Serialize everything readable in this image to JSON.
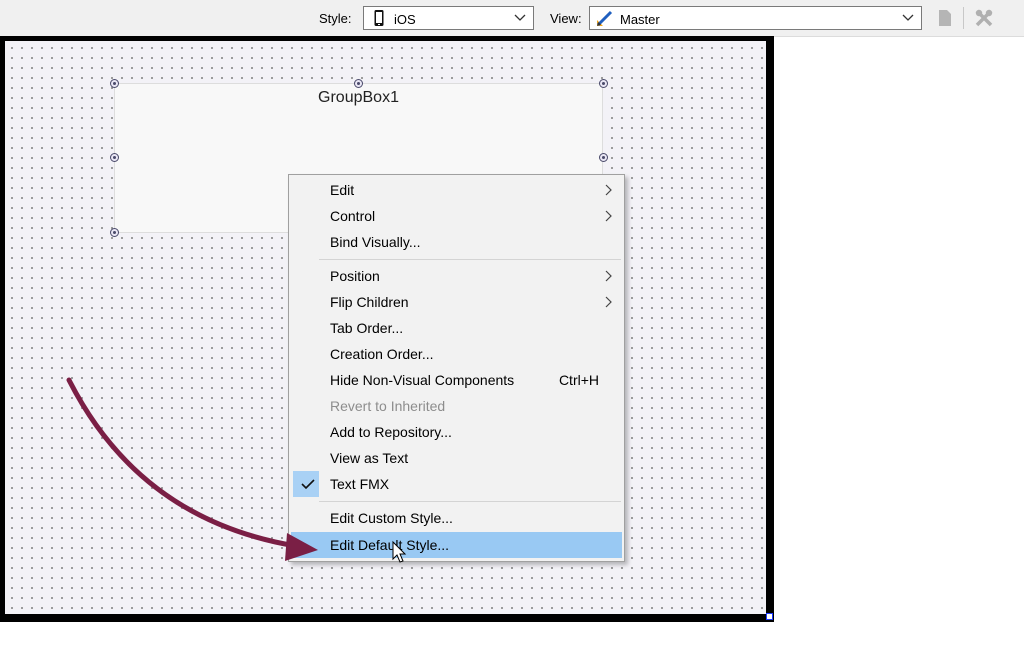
{
  "toolbar": {
    "style_label": "Style:",
    "style_value": "iOS",
    "view_label": "View:",
    "view_value": "Master",
    "icons": [
      "phone-icon",
      "pencil-ruler-icon",
      "document-icon",
      "tools-icon"
    ]
  },
  "groupbox": {
    "title": "GroupBox1"
  },
  "context_menu": {
    "items": [
      {
        "label": "Edit",
        "submenu": true
      },
      {
        "label": "Control",
        "submenu": true
      },
      {
        "label": "Bind Visually..."
      },
      {
        "label": "Position",
        "submenu": true
      },
      {
        "label": "Flip Children",
        "submenu": true
      },
      {
        "label": "Tab Order..."
      },
      {
        "label": "Creation Order..."
      },
      {
        "label": "Hide Non-Visual Components",
        "shortcut": "Ctrl+H"
      },
      {
        "label": "Revert to Inherited",
        "disabled": true
      },
      {
        "label": "Add to Repository..."
      },
      {
        "label": "View as Text"
      },
      {
        "label": "Text FMX",
        "checked": true
      },
      {
        "label": "Edit Custom Style..."
      },
      {
        "label": "Edit Default Style...",
        "highlighted": true
      }
    ]
  },
  "colors": {
    "highlight": "#99c9f3",
    "check_bg": "#a9d1f5",
    "arrow": "#7a1f45",
    "form_border": "#000000",
    "canvas": "#f3f2f7"
  }
}
